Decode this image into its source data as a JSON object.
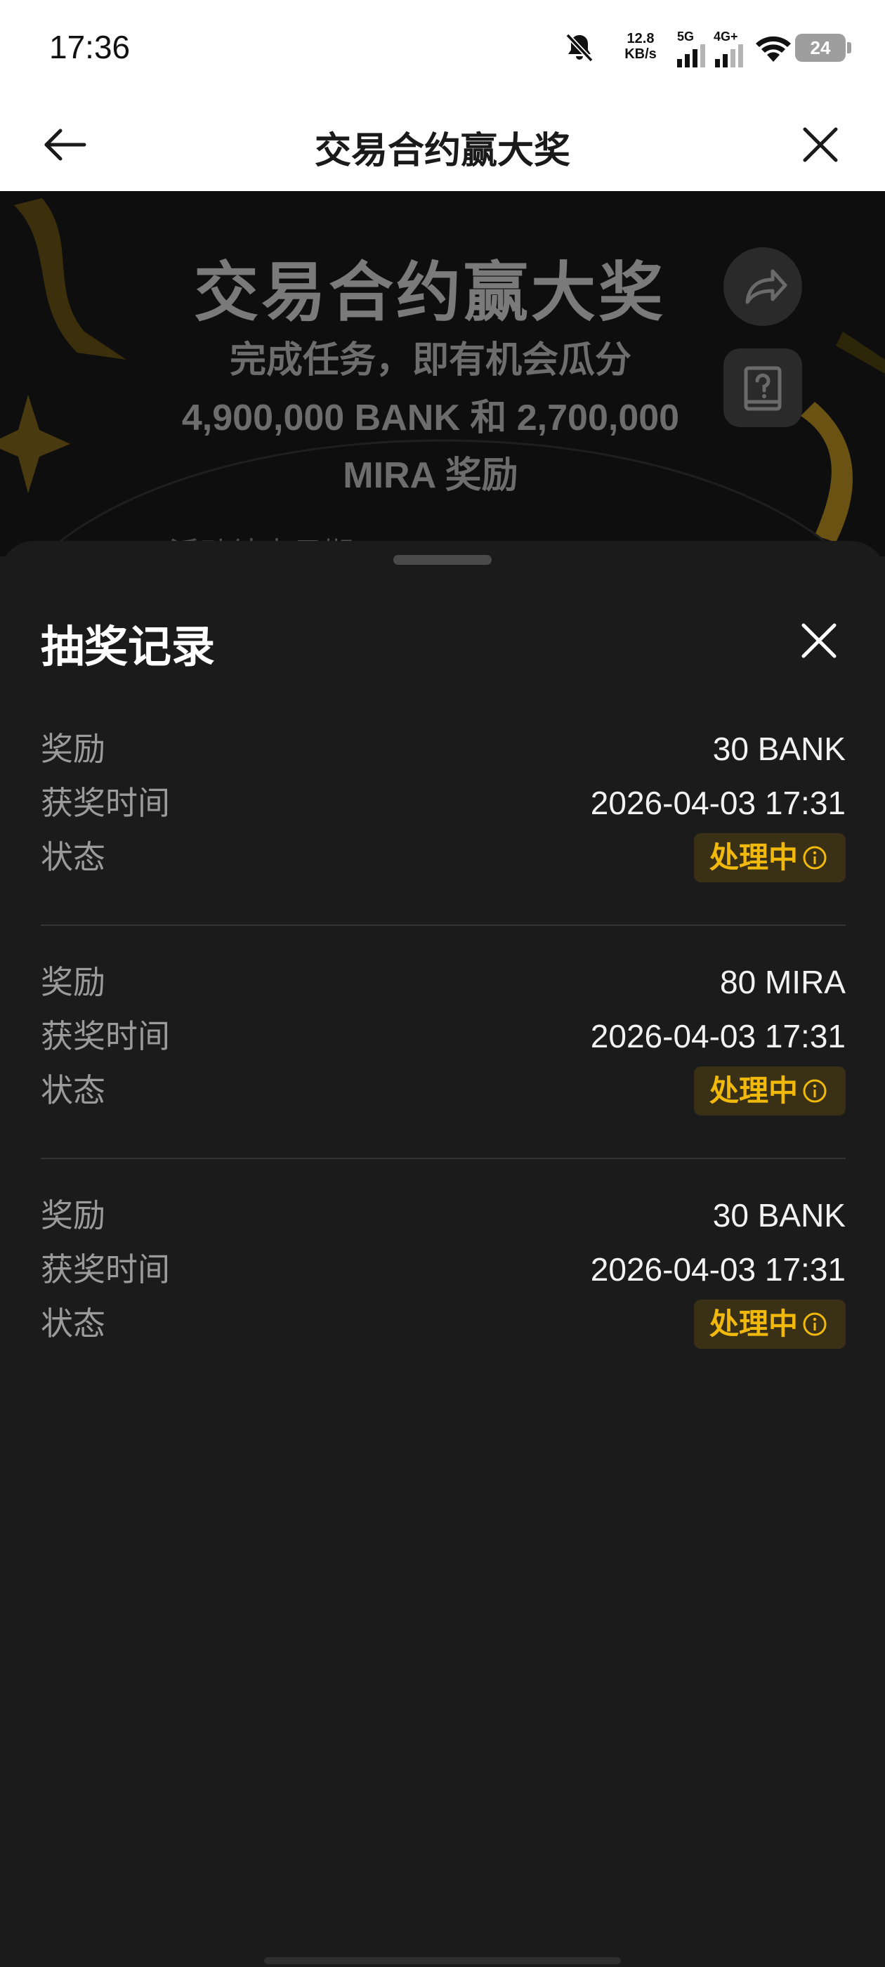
{
  "status_bar": {
    "time": "17:36",
    "net_speed_value": "12.8",
    "net_speed_unit": "KB/s",
    "sim1_label": "5G",
    "sim2_label": "4G+",
    "battery": "24",
    "icons": [
      "bell-muted-icon",
      "signal-icon",
      "signal-icon",
      "wifi-icon",
      "battery-icon"
    ]
  },
  "header": {
    "title": "交易合约赢大奖",
    "back_icon": "arrow-left-icon",
    "close_icon": "close-icon"
  },
  "banner": {
    "title": "交易合约赢大奖",
    "subtitle_line1": "完成任务，即有机会瓜分",
    "subtitle_line2": "4,900,000 BANK 和 2,700,000",
    "subtitle_line3": "MIRA 奖励",
    "cut_text": "活动结束日期",
    "share_icon": "share-icon",
    "rules_icon": "question-book-icon"
  },
  "sheet": {
    "title": "抽奖记录",
    "close_icon": "close-icon",
    "records": [
      {
        "reward_label": "奖励",
        "reward": "30 BANK",
        "time_label": "获奖时间",
        "time": "2026-04-03 17:31",
        "status_label": "状态",
        "status": "处理中"
      },
      {
        "reward_label": "奖励",
        "reward": "80 MIRA",
        "time_label": "获奖时间",
        "time": "2026-04-03 17:31",
        "status_label": "状态",
        "status": "处理中"
      },
      {
        "reward_label": "奖励",
        "reward": "30 BANK",
        "time_label": "获奖时间",
        "time": "2026-04-03 17:31",
        "status_label": "状态",
        "status": "处理中"
      }
    ]
  },
  "colors": {
    "accent": "#f0b90b",
    "sheet_bg": "#1b1b1b",
    "status_badge_bg": "#3a3016"
  }
}
